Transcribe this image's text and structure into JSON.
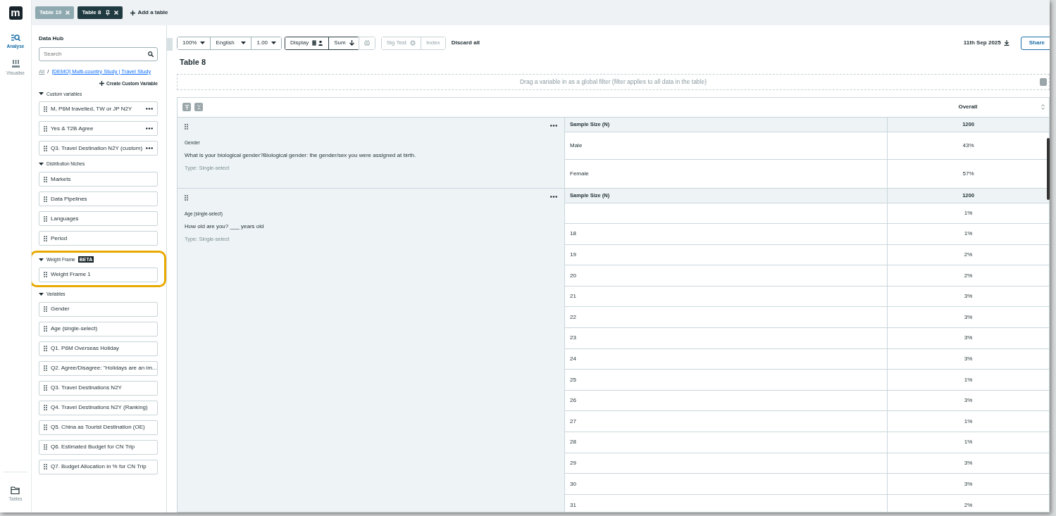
{
  "logo": {
    "text": "m"
  },
  "tabs": [
    {
      "label": "Table 10",
      "selected": false,
      "pinned": false
    },
    {
      "label": "Table 8",
      "selected": true,
      "pinned": true
    }
  ],
  "add_table": "Add a table",
  "rail": {
    "items": [
      {
        "label": "Analyse",
        "kind": "analyse",
        "selected": true
      },
      {
        "label": "Visualise",
        "kind": "visualise",
        "selected": false
      }
    ],
    "bottom": {
      "label": "Tables",
      "kind": "tables",
      "selected": false
    }
  },
  "data_hub": {
    "title": "Data Hub",
    "search": {
      "placeholder": "Search"
    },
    "breadcrumb": [
      "All",
      "[DEMO] Multi-country Study | Travel Study"
    ],
    "breadcrumb_separator": "/",
    "create_button": "Create Custom Variable",
    "sections": [
      {
        "title": "Custom variables",
        "highlighted": false,
        "items": [
          {
            "label": "M, P6M travelled, TW or JP N2Y",
            "menu": true
          },
          {
            "label": "Yes & T2B Agree",
            "menu": true
          },
          {
            "label": "Q3. Travel Destination N2Y (custom)",
            "menu": true
          }
        ]
      },
      {
        "title": "Distribution Niches",
        "highlighted": false,
        "items": [
          {
            "label": "Markets",
            "menu": false
          },
          {
            "label": "Data Pipelines",
            "menu": false
          },
          {
            "label": "Languages",
            "menu": false
          },
          {
            "label": "Period",
            "menu": false
          }
        ]
      },
      {
        "title": "Weight Frame",
        "badge": "BETA",
        "highlighted": true,
        "items": [
          {
            "label": "Weight Frame 1",
            "menu": false
          }
        ]
      },
      {
        "title": "Variables",
        "highlighted": false,
        "items": [
          {
            "label": "Gender",
            "menu": false
          },
          {
            "label": "Age (single-select)",
            "menu": false
          },
          {
            "label": "Q1. P6M Overseas Holiday",
            "menu": false
          },
          {
            "label": "Q2. Agree/Disagree: \"Holidays are an im...",
            "menu": false
          },
          {
            "label": "Q3. Travel Destinations N2Y",
            "menu": false
          },
          {
            "label": "Q4. Travel Destinations N2Y (Ranking)",
            "menu": false
          },
          {
            "label": "Q5. China as Tourist Destination (OE)",
            "menu": false
          },
          {
            "label": "Q6. Estimated Budget for CN Trip",
            "menu": false
          },
          {
            "label": "Q7. Budget Allocation in % for CN Trip",
            "menu": false
          }
        ]
      }
    ]
  },
  "toolbar": {
    "dropdowns": [
      "100%",
      "English",
      "1.00"
    ],
    "display": "Display",
    "sum": "Sum",
    "sig_test": "Sig Test",
    "index": "Index",
    "discard": "Discard all",
    "date": "11th Sep 2025",
    "share": "Share"
  },
  "table_title": "Table 8",
  "filter_hint": "Drag a variable in as a global filter (filter applies to all data in the table)",
  "column_header": "Overall",
  "blocks": [
    {
      "name": "Gender",
      "question": "What is your biological gender?Biological gender: the gender/sex you were assigned at birth.",
      "type": "Type: Single-select",
      "rows": [
        {
          "kind": "sample",
          "label": "Sample Size (N)",
          "value": "1200"
        },
        {
          "kind": "tall",
          "label": "Male",
          "value": "43%"
        },
        {
          "kind": "tall",
          "label": "Female",
          "value": "57%"
        }
      ]
    },
    {
      "name": "Age (single-select)",
      "question": "How old are you? ___ years old",
      "type": "Type: Single-select",
      "rows": [
        {
          "kind": "sample",
          "label": "Sample Size (N)",
          "value": "1200"
        },
        {
          "kind": "row",
          "value": "1%"
        },
        {
          "kind": "row",
          "label": "18",
          "value": "1%"
        },
        {
          "kind": "row",
          "label": "19",
          "value": "2%"
        },
        {
          "kind": "row",
          "label": "20",
          "value": "2%"
        },
        {
          "kind": "row",
          "label": "21",
          "value": "3%"
        },
        {
          "kind": "row",
          "label": "22",
          "value": "3%"
        },
        {
          "kind": "row",
          "label": "23",
          "value": "3%"
        },
        {
          "kind": "row",
          "label": "24",
          "value": "3%"
        },
        {
          "kind": "row",
          "label": "25",
          "value": "1%"
        },
        {
          "kind": "row",
          "label": "26",
          "value": "3%"
        },
        {
          "kind": "row",
          "label": "27",
          "value": "1%"
        },
        {
          "kind": "row",
          "label": "28",
          "value": "1%"
        },
        {
          "kind": "row",
          "label": "29",
          "value": "3%"
        },
        {
          "kind": "row",
          "label": "30",
          "value": "3%"
        },
        {
          "kind": "row",
          "label": "31",
          "value": "2%"
        }
      ]
    }
  ]
}
